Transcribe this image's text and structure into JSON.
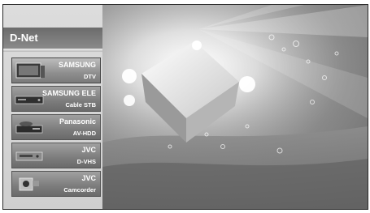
{
  "panel": {
    "title": "D-Net"
  },
  "devices": [
    {
      "maker": "SAMSUNG",
      "type": "DTV",
      "icon": "tv-icon"
    },
    {
      "maker": "SAMSUNG ELE",
      "type": "Cable STB",
      "icon": "set-top-box-icon"
    },
    {
      "maker": "Panasonic",
      "type": "AV-HDD",
      "icon": "hdd-recorder-icon"
    },
    {
      "maker": "JVC",
      "type": "D-VHS",
      "icon": "vcr-icon"
    },
    {
      "maker": "JVC",
      "type": "Camcorder",
      "icon": "camcorder-icon"
    }
  ],
  "colors": {
    "panel_bg": "#cfcfcf",
    "header_bg": "#7a7a7a",
    "device_bg": "#7c7c7c"
  }
}
